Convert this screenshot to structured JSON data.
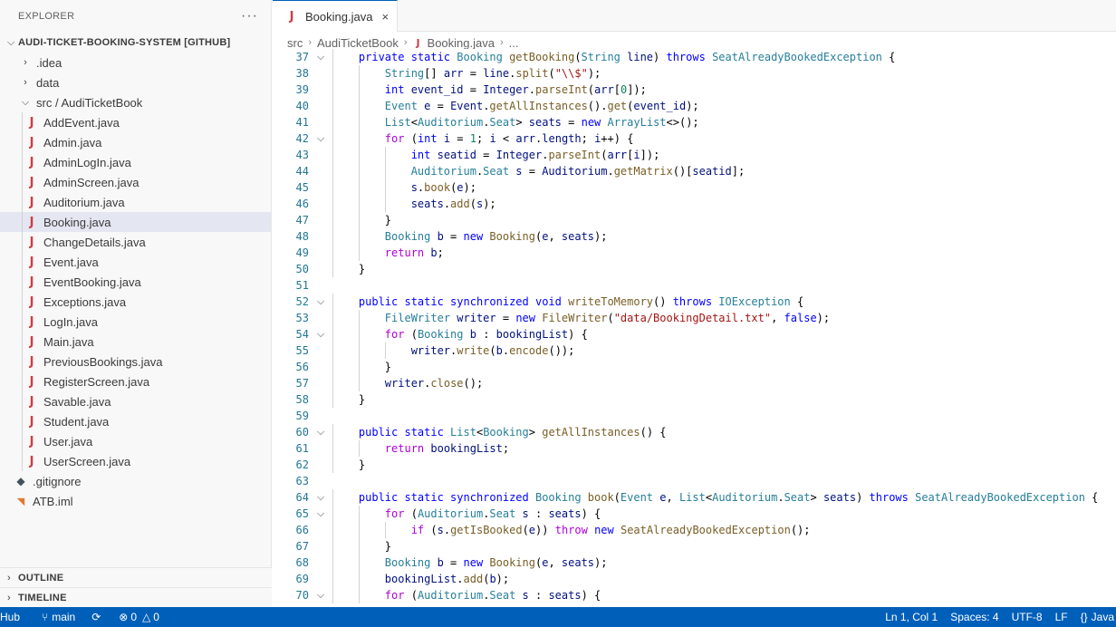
{
  "explorer": {
    "title": "EXPLORER",
    "more_label": "···",
    "root_label": "AUDI-TICKET-BOOKING-SYSTEM [GITHUB]",
    "items": [
      {
        "type": "folder",
        "label": ".idea",
        "expanded": false
      },
      {
        "type": "folder",
        "label": "data",
        "expanded": false
      },
      {
        "type": "folder",
        "label": "src / AudiTicketBook",
        "expanded": true
      },
      {
        "type": "java",
        "label": "AddEvent.java"
      },
      {
        "type": "java",
        "label": "Admin.java"
      },
      {
        "type": "java",
        "label": "AdminLogIn.java"
      },
      {
        "type": "java",
        "label": "AdminScreen.java"
      },
      {
        "type": "java",
        "label": "Auditorium.java"
      },
      {
        "type": "java",
        "label": "Booking.java",
        "selected": true
      },
      {
        "type": "java",
        "label": "ChangeDetails.java"
      },
      {
        "type": "java",
        "label": "Event.java"
      },
      {
        "type": "java",
        "label": "EventBooking.java"
      },
      {
        "type": "java",
        "label": "Exceptions.java"
      },
      {
        "type": "java",
        "label": "LogIn.java"
      },
      {
        "type": "java",
        "label": "Main.java"
      },
      {
        "type": "java",
        "label": "PreviousBookings.java"
      },
      {
        "type": "java",
        "label": "RegisterScreen.java"
      },
      {
        "type": "java",
        "label": "Savable.java"
      },
      {
        "type": "java",
        "label": "Student.java"
      },
      {
        "type": "java",
        "label": "User.java"
      },
      {
        "type": "java",
        "label": "UserScreen.java"
      },
      {
        "type": "git",
        "label": ".gitignore"
      },
      {
        "type": "iml",
        "label": "ATB.iml"
      }
    ],
    "outline_label": "OUTLINE",
    "timeline_label": "TIMELINE"
  },
  "tab": {
    "label": "Booking.java",
    "close_label": "×"
  },
  "breadcrumb": [
    "src",
    "AudiTicketBook",
    "Booking.java",
    "..."
  ],
  "code_lines": [
    {
      "n": 37,
      "fold": true,
      "indent": 1,
      "tokens": [
        [
          "kw",
          "private "
        ],
        [
          "kw",
          "static "
        ],
        [
          "ty",
          "Booking "
        ],
        [
          "fn",
          "getBooking"
        ],
        [
          "pl",
          "("
        ],
        [
          "ty",
          "String "
        ],
        [
          "vr",
          "line"
        ],
        [
          "pl",
          ") "
        ],
        [
          "kw",
          "throws "
        ],
        [
          "ty",
          "SeatAlreadyBookedException "
        ],
        [
          "pl",
          "{"
        ]
      ]
    },
    {
      "n": 38,
      "fold": false,
      "indent": 2,
      "tokens": [
        [
          "ty",
          "String"
        ],
        [
          "pl",
          "[] "
        ],
        [
          "vr",
          "arr "
        ],
        [
          "pl",
          "= "
        ],
        [
          "vr",
          "line"
        ],
        [
          "pl",
          "."
        ],
        [
          "fn",
          "split"
        ],
        [
          "pl",
          "("
        ],
        [
          "st",
          "\"\\\\$\""
        ],
        [
          "pl",
          ");"
        ]
      ]
    },
    {
      "n": 39,
      "fold": false,
      "indent": 2,
      "tokens": [
        [
          "kw",
          "int "
        ],
        [
          "vr",
          "event_id "
        ],
        [
          "pl",
          "= "
        ],
        [
          "vr",
          "Integer"
        ],
        [
          "pl",
          "."
        ],
        [
          "fn",
          "parseInt"
        ],
        [
          "pl",
          "("
        ],
        [
          "vr",
          "arr"
        ],
        [
          "pl",
          "["
        ],
        [
          "nm",
          "0"
        ],
        [
          "pl",
          "]);"
        ]
      ]
    },
    {
      "n": 40,
      "fold": false,
      "indent": 2,
      "tokens": [
        [
          "ty",
          "Event "
        ],
        [
          "vr",
          "e "
        ],
        [
          "pl",
          "= "
        ],
        [
          "vr",
          "Event"
        ],
        [
          "pl",
          "."
        ],
        [
          "fn",
          "getAllInstances"
        ],
        [
          "pl",
          "()."
        ],
        [
          "fn",
          "get"
        ],
        [
          "pl",
          "("
        ],
        [
          "vr",
          "event_id"
        ],
        [
          "pl",
          ");"
        ]
      ]
    },
    {
      "n": 41,
      "fold": false,
      "indent": 2,
      "tokens": [
        [
          "ty",
          "List"
        ],
        [
          "pl",
          "<"
        ],
        [
          "ty",
          "Auditorium"
        ],
        [
          "pl",
          "."
        ],
        [
          "ty",
          "Seat"
        ],
        [
          "pl",
          "> "
        ],
        [
          "vr",
          "seats "
        ],
        [
          "pl",
          "= "
        ],
        [
          "kw",
          "new "
        ],
        [
          "ty",
          "ArrayList"
        ],
        [
          "pl",
          "<>();"
        ]
      ]
    },
    {
      "n": 42,
      "fold": true,
      "indent": 2,
      "tokens": [
        [
          "ctl",
          "for "
        ],
        [
          "pl",
          "("
        ],
        [
          "kw",
          "int "
        ],
        [
          "vr",
          "i "
        ],
        [
          "pl",
          "= "
        ],
        [
          "nm",
          "1"
        ],
        [
          "pl",
          "; "
        ],
        [
          "vr",
          "i "
        ],
        [
          "pl",
          "< "
        ],
        [
          "vr",
          "arr"
        ],
        [
          "pl",
          "."
        ],
        [
          "vr",
          "length"
        ],
        [
          "pl",
          "; "
        ],
        [
          "vr",
          "i"
        ],
        [
          "pl",
          "++) {"
        ]
      ]
    },
    {
      "n": 43,
      "fold": false,
      "indent": 3,
      "tokens": [
        [
          "kw",
          "int "
        ],
        [
          "vr",
          "seatid "
        ],
        [
          "pl",
          "= "
        ],
        [
          "vr",
          "Integer"
        ],
        [
          "pl",
          "."
        ],
        [
          "fn",
          "parseInt"
        ],
        [
          "pl",
          "("
        ],
        [
          "vr",
          "arr"
        ],
        [
          "pl",
          "["
        ],
        [
          "vr",
          "i"
        ],
        [
          "pl",
          "]);"
        ]
      ]
    },
    {
      "n": 44,
      "fold": false,
      "indent": 3,
      "tokens": [
        [
          "ty",
          "Auditorium"
        ],
        [
          "pl",
          "."
        ],
        [
          "ty",
          "Seat "
        ],
        [
          "vr",
          "s "
        ],
        [
          "pl",
          "= "
        ],
        [
          "vr",
          "Auditorium"
        ],
        [
          "pl",
          "."
        ],
        [
          "fn",
          "getMatrix"
        ],
        [
          "pl",
          "()["
        ],
        [
          "vr",
          "seatid"
        ],
        [
          "pl",
          "];"
        ]
      ]
    },
    {
      "n": 45,
      "fold": false,
      "indent": 3,
      "tokens": [
        [
          "vr",
          "s"
        ],
        [
          "pl",
          "."
        ],
        [
          "fn",
          "book"
        ],
        [
          "pl",
          "("
        ],
        [
          "vr",
          "e"
        ],
        [
          "pl",
          ");"
        ]
      ]
    },
    {
      "n": 46,
      "fold": false,
      "indent": 3,
      "tokens": [
        [
          "vr",
          "seats"
        ],
        [
          "pl",
          "."
        ],
        [
          "fn",
          "add"
        ],
        [
          "pl",
          "("
        ],
        [
          "vr",
          "s"
        ],
        [
          "pl",
          ");"
        ]
      ]
    },
    {
      "n": 47,
      "fold": false,
      "indent": 2,
      "tokens": [
        [
          "pl",
          "}"
        ]
      ]
    },
    {
      "n": 48,
      "fold": false,
      "indent": 2,
      "tokens": [
        [
          "ty",
          "Booking "
        ],
        [
          "vr",
          "b "
        ],
        [
          "pl",
          "= "
        ],
        [
          "kw",
          "new "
        ],
        [
          "fn",
          "Booking"
        ],
        [
          "pl",
          "("
        ],
        [
          "vr",
          "e"
        ],
        [
          "pl",
          ", "
        ],
        [
          "vr",
          "seats"
        ],
        [
          "pl",
          ");"
        ]
      ]
    },
    {
      "n": 49,
      "fold": false,
      "indent": 2,
      "tokens": [
        [
          "ctl",
          "return "
        ],
        [
          "vr",
          "b"
        ],
        [
          "pl",
          ";"
        ]
      ]
    },
    {
      "n": 50,
      "fold": false,
      "indent": 1,
      "tokens": [
        [
          "pl",
          "}"
        ]
      ]
    },
    {
      "n": 51,
      "fold": false,
      "indent": 0,
      "tokens": []
    },
    {
      "n": 52,
      "fold": true,
      "indent": 1,
      "tokens": [
        [
          "kw",
          "public "
        ],
        [
          "kw",
          "static "
        ],
        [
          "kw",
          "synchronized "
        ],
        [
          "kw",
          "void "
        ],
        [
          "fn",
          "writeToMemory"
        ],
        [
          "pl",
          "() "
        ],
        [
          "kw",
          "throws "
        ],
        [
          "ty",
          "IOException "
        ],
        [
          "pl",
          "{"
        ]
      ]
    },
    {
      "n": 53,
      "fold": false,
      "indent": 2,
      "tokens": [
        [
          "ty",
          "FileWriter "
        ],
        [
          "vr",
          "writer "
        ],
        [
          "pl",
          "= "
        ],
        [
          "kw",
          "new "
        ],
        [
          "fn",
          "FileWriter"
        ],
        [
          "pl",
          "("
        ],
        [
          "st",
          "\"data/BookingDetail.txt\""
        ],
        [
          "pl",
          ", "
        ],
        [
          "kw",
          "false"
        ],
        [
          "pl",
          ");"
        ]
      ]
    },
    {
      "n": 54,
      "fold": true,
      "indent": 2,
      "tokens": [
        [
          "ctl",
          "for "
        ],
        [
          "pl",
          "("
        ],
        [
          "ty",
          "Booking "
        ],
        [
          "vr",
          "b "
        ],
        [
          "pl",
          ": "
        ],
        [
          "vr",
          "bookingList"
        ],
        [
          "pl",
          ") {"
        ]
      ]
    },
    {
      "n": 55,
      "fold": false,
      "indent": 3,
      "tokens": [
        [
          "vr",
          "writer"
        ],
        [
          "pl",
          "."
        ],
        [
          "fn",
          "write"
        ],
        [
          "pl",
          "("
        ],
        [
          "vr",
          "b"
        ],
        [
          "pl",
          "."
        ],
        [
          "fn",
          "encode"
        ],
        [
          "pl",
          "());"
        ]
      ]
    },
    {
      "n": 56,
      "fold": false,
      "indent": 2,
      "tokens": [
        [
          "pl",
          "}"
        ]
      ]
    },
    {
      "n": 57,
      "fold": false,
      "indent": 2,
      "tokens": [
        [
          "vr",
          "writer"
        ],
        [
          "pl",
          "."
        ],
        [
          "fn",
          "close"
        ],
        [
          "pl",
          "();"
        ]
      ]
    },
    {
      "n": 58,
      "fold": false,
      "indent": 1,
      "tokens": [
        [
          "pl",
          "}"
        ]
      ]
    },
    {
      "n": 59,
      "fold": false,
      "indent": 0,
      "tokens": []
    },
    {
      "n": 60,
      "fold": true,
      "indent": 1,
      "tokens": [
        [
          "kw",
          "public "
        ],
        [
          "kw",
          "static "
        ],
        [
          "ty",
          "List"
        ],
        [
          "pl",
          "<"
        ],
        [
          "ty",
          "Booking"
        ],
        [
          "pl",
          "> "
        ],
        [
          "fn",
          "getAllInstances"
        ],
        [
          "pl",
          "() {"
        ]
      ]
    },
    {
      "n": 61,
      "fold": false,
      "indent": 2,
      "tokens": [
        [
          "ctl",
          "return "
        ],
        [
          "vr",
          "bookingList"
        ],
        [
          "pl",
          ";"
        ]
      ]
    },
    {
      "n": 62,
      "fold": false,
      "indent": 1,
      "tokens": [
        [
          "pl",
          "}"
        ]
      ]
    },
    {
      "n": 63,
      "fold": false,
      "indent": 0,
      "tokens": []
    },
    {
      "n": 64,
      "fold": true,
      "indent": 1,
      "tokens": [
        [
          "kw",
          "public "
        ],
        [
          "kw",
          "static "
        ],
        [
          "kw",
          "synchronized "
        ],
        [
          "ty",
          "Booking "
        ],
        [
          "fn",
          "book"
        ],
        [
          "pl",
          "("
        ],
        [
          "ty",
          "Event "
        ],
        [
          "vr",
          "e"
        ],
        [
          "pl",
          ", "
        ],
        [
          "ty",
          "List"
        ],
        [
          "pl",
          "<"
        ],
        [
          "ty",
          "Auditorium"
        ],
        [
          "pl",
          "."
        ],
        [
          "ty",
          "Seat"
        ],
        [
          "pl",
          "> "
        ],
        [
          "vr",
          "seats"
        ],
        [
          "pl",
          ") "
        ],
        [
          "kw",
          "throws "
        ],
        [
          "ty",
          "SeatAlreadyBookedException "
        ],
        [
          "pl",
          "{"
        ]
      ]
    },
    {
      "n": 65,
      "fold": true,
      "indent": 2,
      "tokens": [
        [
          "ctl",
          "for "
        ],
        [
          "pl",
          "("
        ],
        [
          "ty",
          "Auditorium"
        ],
        [
          "pl",
          "."
        ],
        [
          "ty",
          "Seat "
        ],
        [
          "vr",
          "s "
        ],
        [
          "pl",
          ": "
        ],
        [
          "vr",
          "seats"
        ],
        [
          "pl",
          ") {"
        ]
      ]
    },
    {
      "n": 66,
      "fold": false,
      "indent": 3,
      "tokens": [
        [
          "ctl",
          "if "
        ],
        [
          "pl",
          "("
        ],
        [
          "vr",
          "s"
        ],
        [
          "pl",
          "."
        ],
        [
          "fn",
          "getIsBooked"
        ],
        [
          "pl",
          "("
        ],
        [
          "vr",
          "e"
        ],
        [
          "pl",
          ")) "
        ],
        [
          "ctl",
          "throw "
        ],
        [
          "kw",
          "new "
        ],
        [
          "fn",
          "SeatAlreadyBookedException"
        ],
        [
          "pl",
          "();"
        ]
      ]
    },
    {
      "n": 67,
      "fold": false,
      "indent": 2,
      "tokens": [
        [
          "pl",
          "}"
        ]
      ]
    },
    {
      "n": 68,
      "fold": false,
      "indent": 2,
      "tokens": [
        [
          "ty",
          "Booking "
        ],
        [
          "vr",
          "b "
        ],
        [
          "pl",
          "= "
        ],
        [
          "kw",
          "new "
        ],
        [
          "fn",
          "Booking"
        ],
        [
          "pl",
          "("
        ],
        [
          "vr",
          "e"
        ],
        [
          "pl",
          ", "
        ],
        [
          "vr",
          "seats"
        ],
        [
          "pl",
          ");"
        ]
      ]
    },
    {
      "n": 69,
      "fold": false,
      "indent": 2,
      "tokens": [
        [
          "vr",
          "bookingList"
        ],
        [
          "pl",
          "."
        ],
        [
          "fn",
          "add"
        ],
        [
          "pl",
          "("
        ],
        [
          "vr",
          "b"
        ],
        [
          "pl",
          ");"
        ]
      ]
    },
    {
      "n": 70,
      "fold": true,
      "indent": 2,
      "tokens": [
        [
          "ctl",
          "for "
        ],
        [
          "pl",
          "("
        ],
        [
          "ty",
          "Auditorium"
        ],
        [
          "pl",
          "."
        ],
        [
          "ty",
          "Seat "
        ],
        [
          "vr",
          "s "
        ],
        [
          "pl",
          ": "
        ],
        [
          "vr",
          "seats"
        ],
        [
          "pl",
          ") {"
        ]
      ]
    }
  ],
  "statusbar": {
    "remote": "Hub",
    "branch": "main",
    "sync_icon": "sync-icon",
    "errors": "0",
    "warnings": "0",
    "position": "Ln 1, Col 1",
    "spaces": "Spaces: 4",
    "encoding": "UTF-8",
    "eol": "LF",
    "language": "Java"
  },
  "colors": {
    "accent": "#005fb8",
    "java_icon": "#cc3e44",
    "line_number": "#237893"
  }
}
